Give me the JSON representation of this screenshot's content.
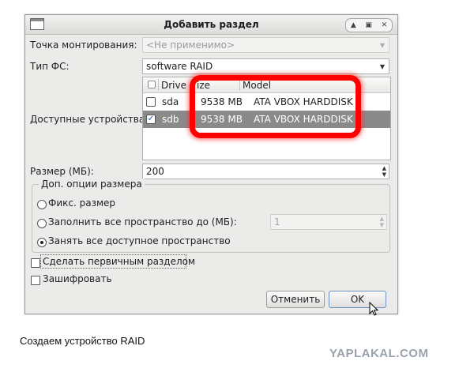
{
  "dialog": {
    "title": "Добавить раздел",
    "window_buttons": [
      "up-icon",
      "restore-icon",
      "close-icon"
    ],
    "mount_point": {
      "label": "Точка монтирования:",
      "value": "<Не применимо>",
      "disabled": true
    },
    "fs_type": {
      "label": "Тип ФС:",
      "value": "software RAID"
    },
    "devices": {
      "label": "Доступные устройства:",
      "columns": [
        "Drive",
        "ize",
        "Model"
      ],
      "rows": [
        {
          "drive": "sda",
          "size": "9538 MB",
          "model": "ATA VBOX HARDDISK",
          "checked": false,
          "selected": false
        },
        {
          "drive": "sdb",
          "size": "9538 MB",
          "model": "ATA VBOX HARDDISK",
          "checked": true,
          "selected": true
        }
      ]
    },
    "size": {
      "label": "Размер (МБ):",
      "value": "200"
    },
    "size_options": {
      "legend": "Доп. опции размера",
      "fixed": "Фикс. размер",
      "fill_up_to": "Заполнить все пространство до (МБ):",
      "fill_up_to_value": "1",
      "fill_all": "Занять все доступное пространство",
      "selected": "fill_all"
    },
    "primary": {
      "label": "Сделать первичным разделом",
      "checked": false
    },
    "encrypt": {
      "label": "Зашифровать",
      "checked": false
    },
    "cancel_label": "Отменить",
    "ok_label": "OK"
  },
  "caption": "Создаем устройство RAID",
  "watermark": "YAPLAKAL.COM",
  "colors": {
    "highlight": "#ff0000",
    "selected_row": "#8a8a8a",
    "dialog_bg": "#ebebea"
  }
}
